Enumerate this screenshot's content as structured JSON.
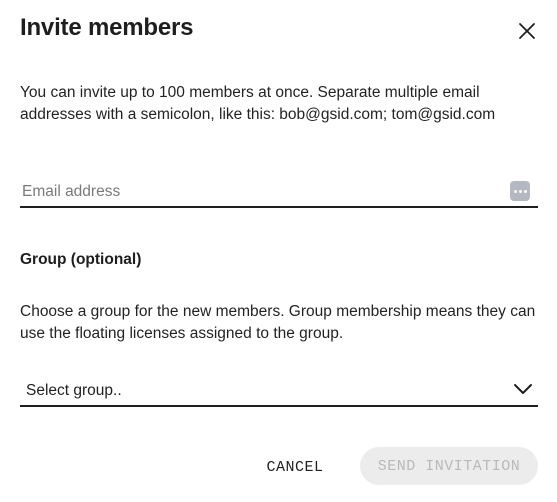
{
  "dialog": {
    "title": "Invite members",
    "close_icon": "close-icon",
    "intro_text": "You can invite up to 100 members at once. Separate multiple email addresses with a semicolon, like this: bob@gsid.com; tom@gsid.com",
    "email": {
      "value": "",
      "placeholder": "Email address",
      "icon": "more-dots-icon"
    },
    "group": {
      "label": "Group (optional)",
      "description": "Choose a group for the new members. Group membership means they can use the floating licenses assigned to the group.",
      "selected": "Select group..",
      "icon": "chevron-down-icon"
    },
    "actions": {
      "cancel_label": "CANCEL",
      "send_label": "SEND INVITATION",
      "send_disabled": true
    }
  },
  "colors": {
    "text": "#1f1f1f",
    "placeholder": "#7a7a7a",
    "disabled_button_bg": "#ececec",
    "disabled_button_text": "#b9b9b9",
    "dots_icon_bg": "#b3b8c2"
  }
}
